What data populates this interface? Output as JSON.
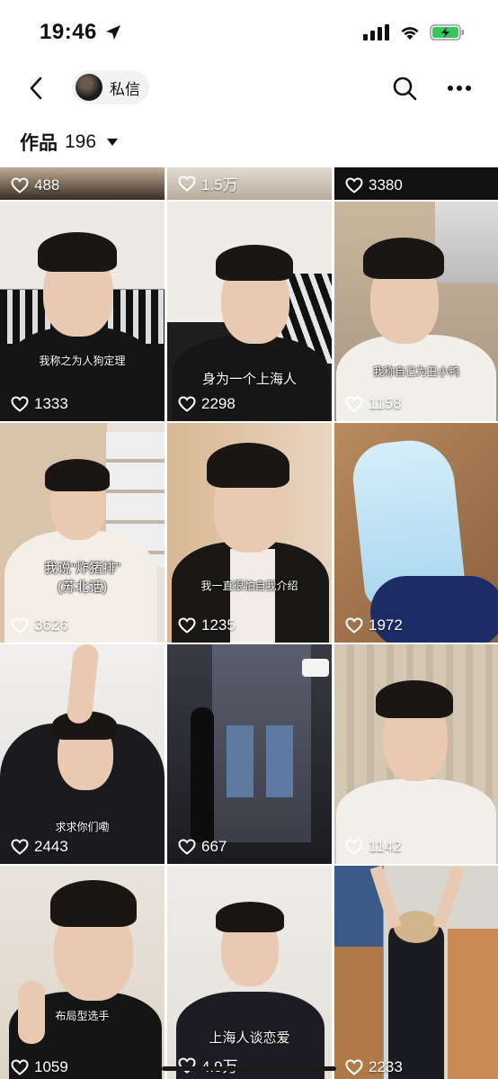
{
  "status": {
    "time": "19:46"
  },
  "nav": {
    "dm_label": "私信"
  },
  "works": {
    "label": "作品",
    "count": "196"
  },
  "tiles": [
    {
      "likes": "488",
      "caption": ""
    },
    {
      "likes": "1.5万",
      "caption": ""
    },
    {
      "likes": "3380",
      "caption": ""
    },
    {
      "likes": "1333",
      "caption": "我称之为人狗定理"
    },
    {
      "likes": "2298",
      "caption": "身为一个上海人"
    },
    {
      "likes": "1158",
      "caption": "我称自己为丑小鸭"
    },
    {
      "likes": "3626",
      "caption": "我说“炸猪排”\n(苏北话)"
    },
    {
      "likes": "1235",
      "caption": "我一直很怕自我介绍"
    },
    {
      "likes": "1972",
      "caption": ""
    },
    {
      "likes": "2443",
      "caption": "求求你们嘞"
    },
    {
      "likes": "667",
      "caption": ""
    },
    {
      "likes": "1142",
      "caption": ""
    },
    {
      "likes": "1059",
      "caption": "布局型选手"
    },
    {
      "likes": "4.9万",
      "caption": "上海人谈恋爱"
    },
    {
      "likes": "2233",
      "caption": ""
    }
  ],
  "colors": {
    "accent_green": "#34c759",
    "pill_bg": "#f2f2f2"
  }
}
